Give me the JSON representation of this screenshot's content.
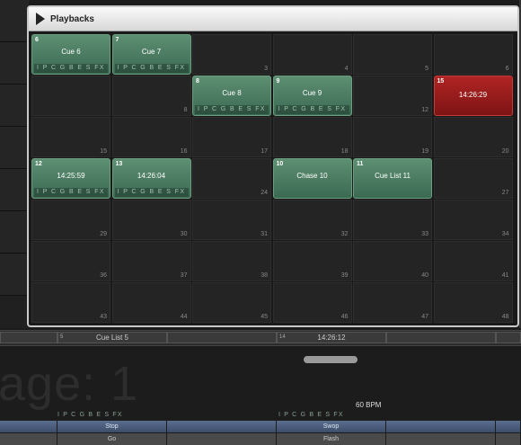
{
  "window": {
    "title": "Playbacks"
  },
  "cells": [
    {
      "num": "6",
      "name": "Cue 6",
      "attrs": "I P C G B E S FX",
      "state": "green"
    },
    {
      "num": "7",
      "name": "Cue 7",
      "attrs": "I P C G B E S FX",
      "state": "green"
    },
    {
      "num": "3",
      "state": "empty"
    },
    {
      "num": "4",
      "state": "empty"
    },
    {
      "num": "5",
      "state": "empty"
    },
    {
      "num": "6",
      "state": "empty"
    },
    {
      "num": "",
      "state": "empty"
    },
    {
      "num": "8",
      "state": "empty"
    },
    {
      "num": "8",
      "name": "Cue 8",
      "attrs": "I P C G B E S FX",
      "state": "green"
    },
    {
      "num": "9",
      "name": "Cue 9",
      "attrs": "I P C G B E S FX",
      "state": "green"
    },
    {
      "num": "12",
      "state": "empty"
    },
    {
      "num": "15",
      "name": "14:26:29",
      "state": "red"
    },
    {
      "num": "15",
      "state": "empty"
    },
    {
      "num": "16",
      "state": "empty"
    },
    {
      "num": "17",
      "state": "empty"
    },
    {
      "num": "18",
      "state": "empty"
    },
    {
      "num": "19",
      "state": "empty"
    },
    {
      "num": "20",
      "state": "empty"
    },
    {
      "num": "12",
      "name": "14:25:59",
      "attrs": "I P C G B E S FX",
      "state": "green"
    },
    {
      "num": "13",
      "name": "14:26:04",
      "attrs": "I P C G B E S FX",
      "state": "green"
    },
    {
      "num": "24",
      "state": "empty"
    },
    {
      "num": "10",
      "name": "Chase 10",
      "state": "green"
    },
    {
      "num": "11",
      "name": "Cue List 11",
      "state": "green"
    },
    {
      "num": "27",
      "state": "empty"
    },
    {
      "num": "29",
      "state": "empty"
    },
    {
      "num": "30",
      "state": "empty"
    },
    {
      "num": "31",
      "state": "empty"
    },
    {
      "num": "32",
      "state": "empty"
    },
    {
      "num": "33",
      "state": "empty"
    },
    {
      "num": "34",
      "state": "empty"
    },
    {
      "num": "36",
      "state": "empty"
    },
    {
      "num": "37",
      "state": "empty"
    },
    {
      "num": "38",
      "state": "empty"
    },
    {
      "num": "39",
      "state": "empty"
    },
    {
      "num": "40",
      "state": "empty"
    },
    {
      "num": "41",
      "state": "empty"
    },
    {
      "num": "43",
      "state": "empty"
    },
    {
      "num": "44",
      "state": "empty"
    },
    {
      "num": "45",
      "state": "empty"
    },
    {
      "num": "46",
      "state": "empty"
    },
    {
      "num": "47",
      "state": "empty"
    },
    {
      "num": "48",
      "state": "empty"
    }
  ],
  "status": {
    "slot1_num": "5",
    "slot1_label": "Cue List 5",
    "slot2_num": "14",
    "slot2_label": "14:26:12"
  },
  "page_label": "age: 1",
  "bpm": "60 BPM",
  "attr_left": "I P C G B E S FX",
  "attr_right": "I P C G B E S FX",
  "buttons": {
    "stop": "Stop",
    "swop": "Swop",
    "go": "Go",
    "flash": "Flash"
  },
  "colors": {
    "active": "#4f7f64",
    "live": "#9e1c1c",
    "accent": "#4b5d7c"
  }
}
